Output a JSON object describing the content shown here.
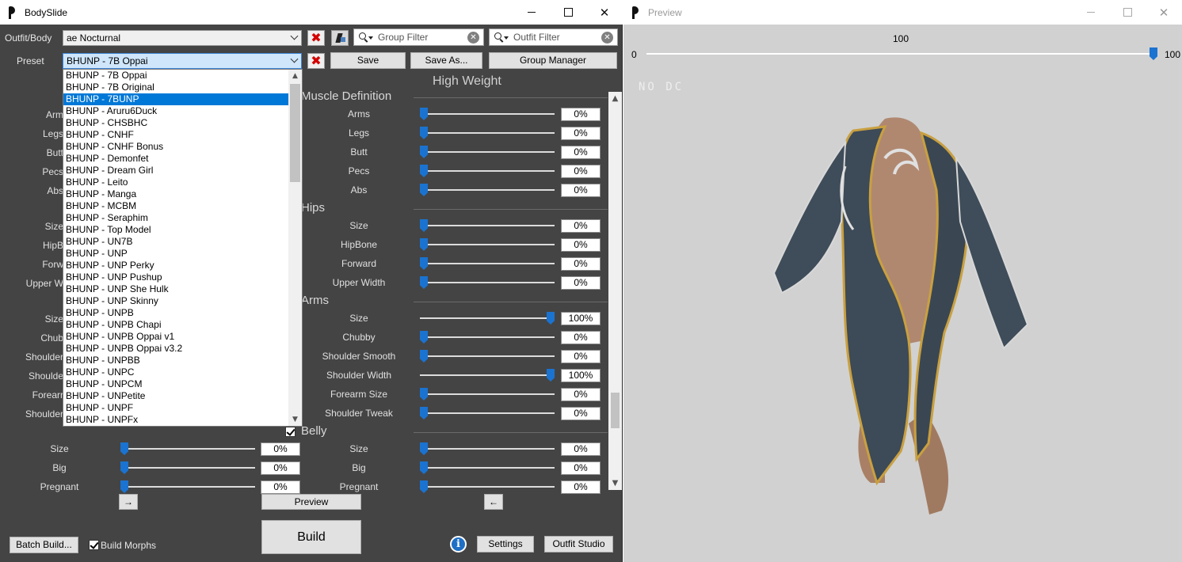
{
  "bodyslide": {
    "title": "BodySlide",
    "outfit_label": "Outfit/Body",
    "outfit_value": "ae Nocturnal",
    "preset_label": "Preset",
    "preset_value": "BHUNP - 7B Oppai",
    "group_filter_placeholder": "Group Filter",
    "outfit_filter_placeholder": "Outfit Filter",
    "save_label": "Save",
    "save_as_label": "Save As...",
    "group_manager_label": "Group Manager",
    "high_weight_header": "High Weight",
    "preset_list": [
      "BHUNP - 7B Oppai",
      "BHUNP - 7B Original",
      "BHUNP - 7BUNP",
      "BHUNP - Aruru6Duck",
      "BHUNP - CHSBHC",
      "BHUNP - CNHF",
      "BHUNP - CNHF Bonus",
      "BHUNP - Demonfet",
      "BHUNP - Dream Girl",
      "BHUNP - Leito",
      "BHUNP - Manga",
      "BHUNP - MCBM",
      "BHUNP - Seraphim",
      "BHUNP - Top Model",
      "BHUNP - UN7B",
      "BHUNP - UNP",
      "BHUNP - UNP Perky",
      "BHUNP - UNP Pushup",
      "BHUNP - UNP She Hulk",
      "BHUNP - UNP Skinny",
      "BHUNP - UNPB",
      "BHUNP - UNPB Chapi",
      "BHUNP - UNPB Oppai v1",
      "BHUNP - UNPB Oppai v3.2",
      "BHUNP - UNPBB",
      "BHUNP - UNPC",
      "BHUNP - UNPCM",
      "BHUNP - UNPetite",
      "BHUNP - UNPF",
      "BHUNP - UNPFx"
    ],
    "preset_selected_index": 2,
    "left_partial_labels": [
      "Arm",
      "Legs",
      "Butt",
      "Pecs",
      "Abs",
      "Size",
      "HipB",
      "Forw",
      "Upper W",
      "Size",
      "Chub",
      "Shoulder",
      "Shoulde",
      "Forearr",
      "Shoulder"
    ],
    "sections": [
      {
        "title": "Muscle Definition",
        "rows": [
          {
            "label": "Arms",
            "value": "0%",
            "level": 0
          },
          {
            "label": "Legs",
            "value": "0%",
            "level": 0
          },
          {
            "label": "Butt",
            "value": "0%",
            "level": 0
          },
          {
            "label": "Pecs",
            "value": "0%",
            "level": 0
          },
          {
            "label": "Abs",
            "value": "0%",
            "level": 0
          }
        ]
      },
      {
        "title": "Hips",
        "rows": [
          {
            "label": "Size",
            "value": "0%",
            "level": 0
          },
          {
            "label": "HipBone",
            "value": "0%",
            "level": 0
          },
          {
            "label": "Forward",
            "value": "0%",
            "level": 0
          },
          {
            "label": "Upper Width",
            "value": "0%",
            "level": 0
          }
        ]
      },
      {
        "title": "Arms",
        "rows": [
          {
            "label": "Size",
            "value": "100%",
            "level": 1
          },
          {
            "label": "Chubby",
            "value": "0%",
            "level": 0
          },
          {
            "label": "Shoulder Smooth",
            "value": "0%",
            "level": 0
          },
          {
            "label": "Shoulder Width",
            "value": "100%",
            "level": 1
          },
          {
            "label": "Forearm Size",
            "value": "0%",
            "level": 0
          },
          {
            "label": "Shoulder Tweak",
            "value": "0%",
            "level": 0
          }
        ]
      }
    ],
    "belly": {
      "title": "Belly",
      "rows": [
        {
          "label": "Size",
          "low_value": "0%",
          "high_value": "0%",
          "low_level": 0,
          "high_level": 0
        },
        {
          "label": "Big",
          "low_value": "0%",
          "high_value": "0%",
          "low_level": 0,
          "high_level": 0
        },
        {
          "label": "Pregnant",
          "low_value": "0%",
          "high_value": "0%",
          "low_level": 0,
          "high_level": 0
        }
      ]
    },
    "arrow_right_label": "→",
    "arrow_left_label": "←",
    "preview_label": "Preview",
    "build_label": "Build",
    "batch_build_label": "Batch Build...",
    "build_morphs_label": "Build Morphs",
    "build_morphs_checked": true,
    "settings_label": "Settings",
    "outfit_studio_label": "Outfit Studio",
    "info_label": "i"
  },
  "preview": {
    "title": "Preview",
    "weight_current": "100",
    "weight_min": "0",
    "weight_max": "100",
    "weight_level": 1,
    "watermark": "NO DC"
  },
  "colors": {
    "panel_bg": "#444444",
    "accent": "#1a73d0",
    "selection": "#0078d7",
    "preview_bg": "#d1d1d1"
  }
}
